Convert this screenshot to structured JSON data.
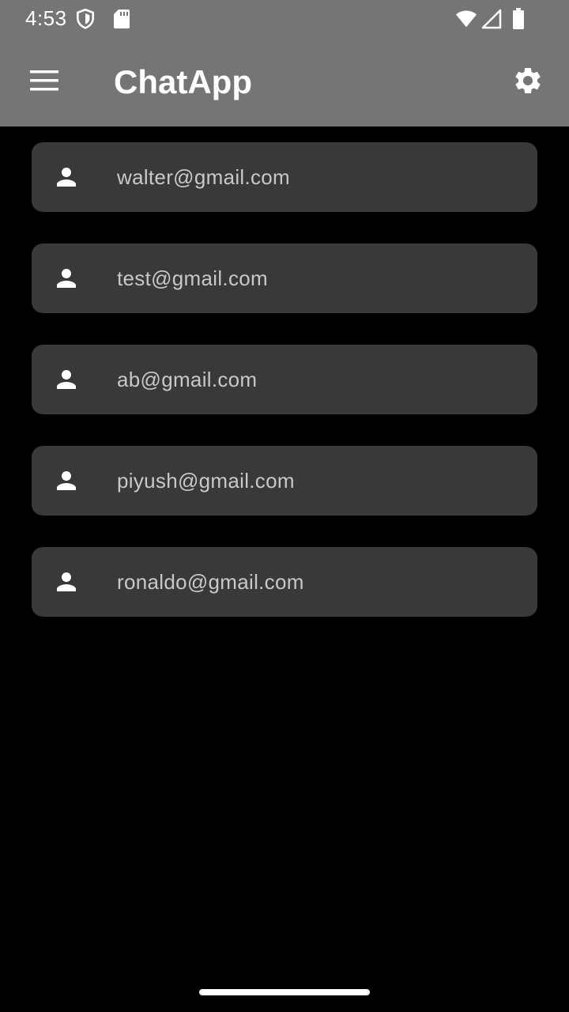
{
  "status_bar": {
    "time": "4:53",
    "icons": [
      "shield-icon",
      "sd-card-icon",
      "wifi-icon",
      "signal-icon",
      "battery-icon"
    ]
  },
  "app_bar": {
    "title": "ChatApp",
    "menu_icon": "menu-icon",
    "settings_icon": "gear-icon",
    "background": "#757575"
  },
  "contacts": [
    {
      "email": "walter@gmail.com",
      "icon": "person-icon"
    },
    {
      "email": "test@gmail.com",
      "icon": "person-icon"
    },
    {
      "email": "ab@gmail.com",
      "icon": "person-icon"
    },
    {
      "email": "piyush@gmail.com",
      "icon": "person-icon"
    },
    {
      "email": "ronaldo@gmail.com",
      "icon": "person-icon"
    }
  ],
  "colors": {
    "background": "#000000",
    "card": "#393939",
    "card_text": "#c8c8c8"
  }
}
